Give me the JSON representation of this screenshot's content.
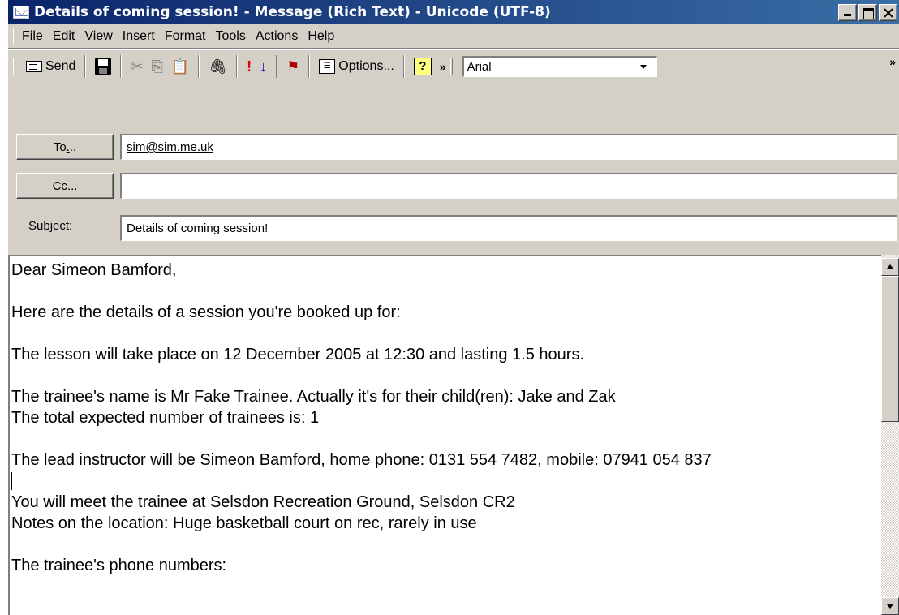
{
  "window": {
    "title": "Details of coming session! - Message (Rich Text)  - Unicode (UTF-8)"
  },
  "menu": {
    "items": [
      {
        "label_pre": "",
        "label_u": "F",
        "label_post": "ile"
      },
      {
        "label_pre": "",
        "label_u": "E",
        "label_post": "dit"
      },
      {
        "label_pre": "",
        "label_u": "V",
        "label_post": "iew"
      },
      {
        "label_pre": "",
        "label_u": "I",
        "label_post": "nsert"
      },
      {
        "label_pre": "F",
        "label_u": "o",
        "label_post": "rmat"
      },
      {
        "label_pre": "",
        "label_u": "T",
        "label_post": "ools"
      },
      {
        "label_pre": "",
        "label_u": "A",
        "label_post": "ctions"
      },
      {
        "label_pre": "",
        "label_u": "H",
        "label_post": "elp"
      }
    ]
  },
  "toolbar": {
    "send_label_u": "S",
    "send_label_post": "end",
    "options_pre": "Op",
    "options_u": "t",
    "options_post": "ions...",
    "font_value": "Arial",
    "more_chevron": "»"
  },
  "header": {
    "to_button_pre": "To",
    "to_button_u": ".",
    "to_button_post": "..",
    "to_value": "sim@sim.me.uk",
    "cc_button_u": "C",
    "cc_button_post": "c...",
    "cc_value": "",
    "subject_label_pre": "Sub",
    "subject_label_u": "j",
    "subject_label_post": "ect:",
    "subject_value": "Details of coming session!"
  },
  "body": {
    "greeting": "Dear Simeon Bamford,",
    "line_intro": "Here are the details of a session you're booked up for:",
    "line_lesson": "The lesson will take place on 12 December 2005 at 12:30 and lasting  1.5 hours.",
    "line_trainee": "The trainee's name is Mr Fake Trainee. Actually it's for their child(ren): Jake and Zak",
    "line_total": "The total expected number of trainees is:  1",
    "line_instructor": "The lead instructor will be Simeon Bamford, home phone: 0131 554 7482, mobile: 07941 054 837",
    "line_meet": "You will meet the trainee at Selsdon Recreation Ground, Selsdon CR2",
    "line_notes": "Notes on the location: Huge basketball court on rec, rarely in use",
    "line_phones": "The trainee's phone numbers:"
  },
  "colors": {
    "titlebar_start": "#0a246a",
    "titlebar_end": "#3a6ea5",
    "chrome": "#d4d0c8",
    "urgent_red": "#e00000",
    "low_blue": "#0000c0"
  }
}
